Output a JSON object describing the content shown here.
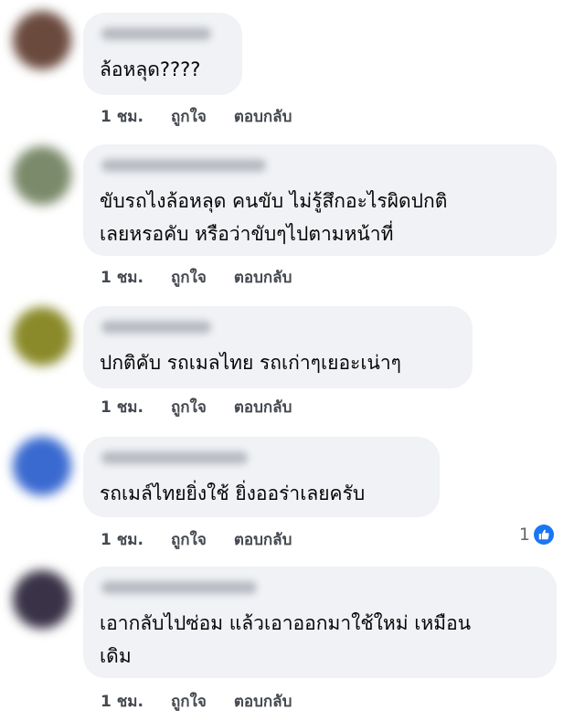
{
  "actions": {
    "time": "1 ชม.",
    "like": "ถูกใจ",
    "reply": "ตอบกลับ"
  },
  "comments": [
    {
      "text": "ล้อหลุด????",
      "avatar_color": "#6b4a3e"
    },
    {
      "text": "ขับรถไงล้อหลุด คนขับ ไม่รู้สึกอะไรผิดปกติ\nเลยหรอคับ หรือว่าขับๆไปตามหน้าที่",
      "avatar_color": "#7a8a6a"
    },
    {
      "text": "ปกติคับ รถเมลไทย รถเก่าๆเยอะเน่าๆ",
      "avatar_color": "#8a8a2a"
    },
    {
      "text": "รถเมล์ไทยยิ่งใช้ ยิ่งออร่าเลยครับ",
      "avatar_color": "#3a6ad0",
      "reaction_count": "1"
    },
    {
      "text": "เอากลับไปซ่อม แล้วเอาออกมาใช้ใหม่ เหมือน\nเดิม",
      "avatar_color": "#3a3348"
    }
  ],
  "colors": {
    "bubble": "#f0f2f5",
    "like_blue": "#1877f2"
  },
  "icons": {
    "reaction": "like-thumb-icon"
  }
}
